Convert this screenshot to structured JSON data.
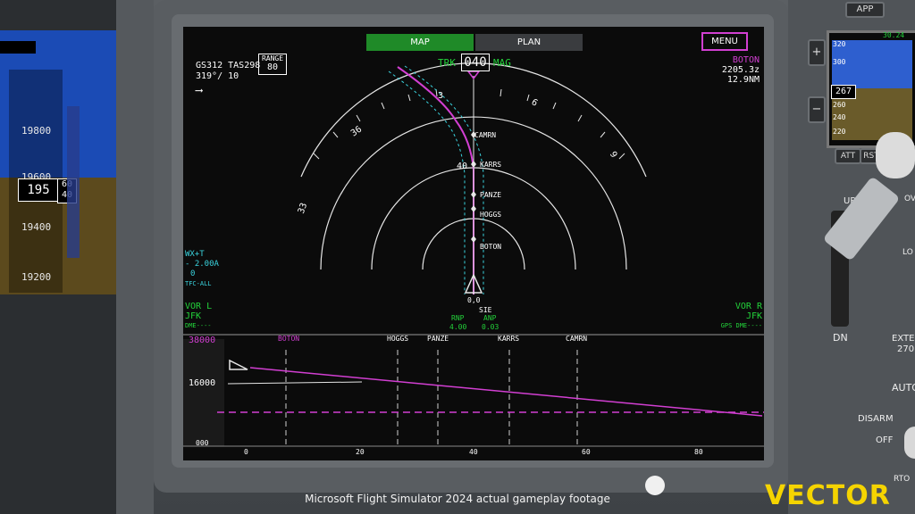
{
  "left_pfd": {
    "altitudes": [
      "19800",
      "19600",
      "19400",
      "19200"
    ],
    "current_altitude_major": "195",
    "current_altitude_minor_top": "60",
    "current_altitude_minor_bottom": "40"
  },
  "nd": {
    "tabs": {
      "map": "MAP",
      "plan": "PLAN"
    },
    "menu_label": "MENU",
    "colors": {
      "green": "#23d23a",
      "magenta": "#d23fd2",
      "cyan": "#3ad3de",
      "white": "#ffffff",
      "tab_active": "#1f8a28",
      "tab_inactive": "#3a3c3f"
    },
    "speeds": {
      "gs_label": "GS",
      "gs": "312",
      "tas_label": "TAS",
      "tas": "298",
      "wind": "319°/ 10"
    },
    "range": {
      "label": "RANGE",
      "value": "80"
    },
    "track": {
      "trk_label": "TRK",
      "heading": "040",
      "mag_label": "MAG"
    },
    "next_wpt": {
      "name": "BOTON",
      "eta": "2205.3z",
      "distance": "12.9NM"
    },
    "compass_labels": [
      "33",
      "36",
      "3",
      "6",
      "9"
    ],
    "arc_value": "40",
    "waypoints": [
      "CAMRN",
      "KARRS",
      "PANZE",
      "HOGGS",
      "BOTON"
    ],
    "own_ship": {
      "label1": "0,0",
      "label2": "SIE"
    },
    "rnp": {
      "rnp_label": "RNP",
      "rnp_value": "4.00",
      "anp_label": "ANP",
      "anp_value": "0.03"
    },
    "wx": {
      "line1": "WX+T",
      "line2": "- 2.00A",
      "line3": "0",
      "line4": "TFC-ALL"
    },
    "vor_l": {
      "label": "VOR L",
      "station": "JFK",
      "mode": "DME----"
    },
    "vor_r": {
      "label": "VOR R",
      "station": "JFK",
      "mode": "GPS DME----"
    }
  },
  "vsd": {
    "top_altitude": "38000",
    "mid_altitude": "16000",
    "bottom_altitude": "000",
    "waypoints": [
      "BOTON",
      "HOGGS",
      "PANZE",
      "KARRS",
      "CAMRN"
    ],
    "distance_ticks": [
      "0",
      "20",
      "40",
      "60",
      "80"
    ]
  },
  "right_panel": {
    "app_label": "APP",
    "speed_top": "320",
    "speed_a": "300",
    "speed_b": "260",
    "speed_c": "240",
    "speed_d": "220",
    "speed_current": "267",
    "green_readout": "30.24",
    "att_label": "ATT",
    "rst_label": "RST",
    "up_label": "UP",
    "dn_label": "DN",
    "lo_label": "LO",
    "ov_label": "OV",
    "ext_label": "EXTE",
    "ext_value": "270",
    "auto_label": "AUTO",
    "disarm_label": "DISARM",
    "off_label": "OFF",
    "rto_label": "RTO",
    "plus": "+",
    "minus": "−"
  },
  "footer": {
    "caption": "Microsoft Flight Simulator 2024 actual gameplay footage",
    "brand": "VECTOR"
  }
}
